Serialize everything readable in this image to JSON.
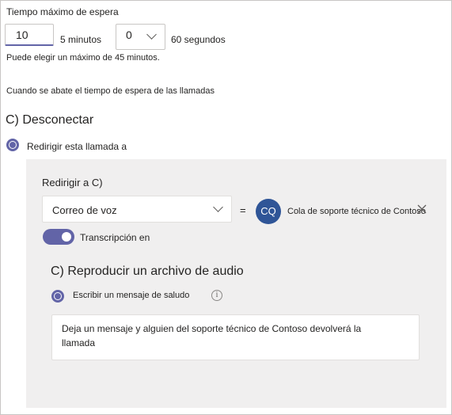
{
  "wait_time": {
    "title": "Tiempo máximo de espera",
    "minutes_value": "10",
    "minutes_label": "5 minutos",
    "seconds_value": "0",
    "seconds_label": "60 segundos",
    "hint": "Puede elegir un máximo de 45 minutos."
  },
  "timeout": {
    "description": "Cuando se abate el tiempo de espera de las llamadas",
    "disconnect_heading": "C) Desconectar",
    "redirect_option": "Redirigir esta llamada a"
  },
  "redirect_panel": {
    "title": "Redirigir a C)",
    "target_select": "Correo de voz",
    "equals": "=",
    "avatar_initials": "CQ",
    "queue_name": "Cola de soporte técnico de Contoso",
    "transcription_label": "Transcripción en",
    "transcription_on": true
  },
  "audio": {
    "heading": "C) Reproducir un archivo de audio",
    "greeting_option": "Escribir un mensaje de saludo",
    "message": "Deja un mensaje y alguien del soporte técnico de Contoso devolverá la llamada"
  },
  "colors": {
    "accent": "#6264a7",
    "avatar": "#2f5597",
    "panel": "#f0efef"
  }
}
